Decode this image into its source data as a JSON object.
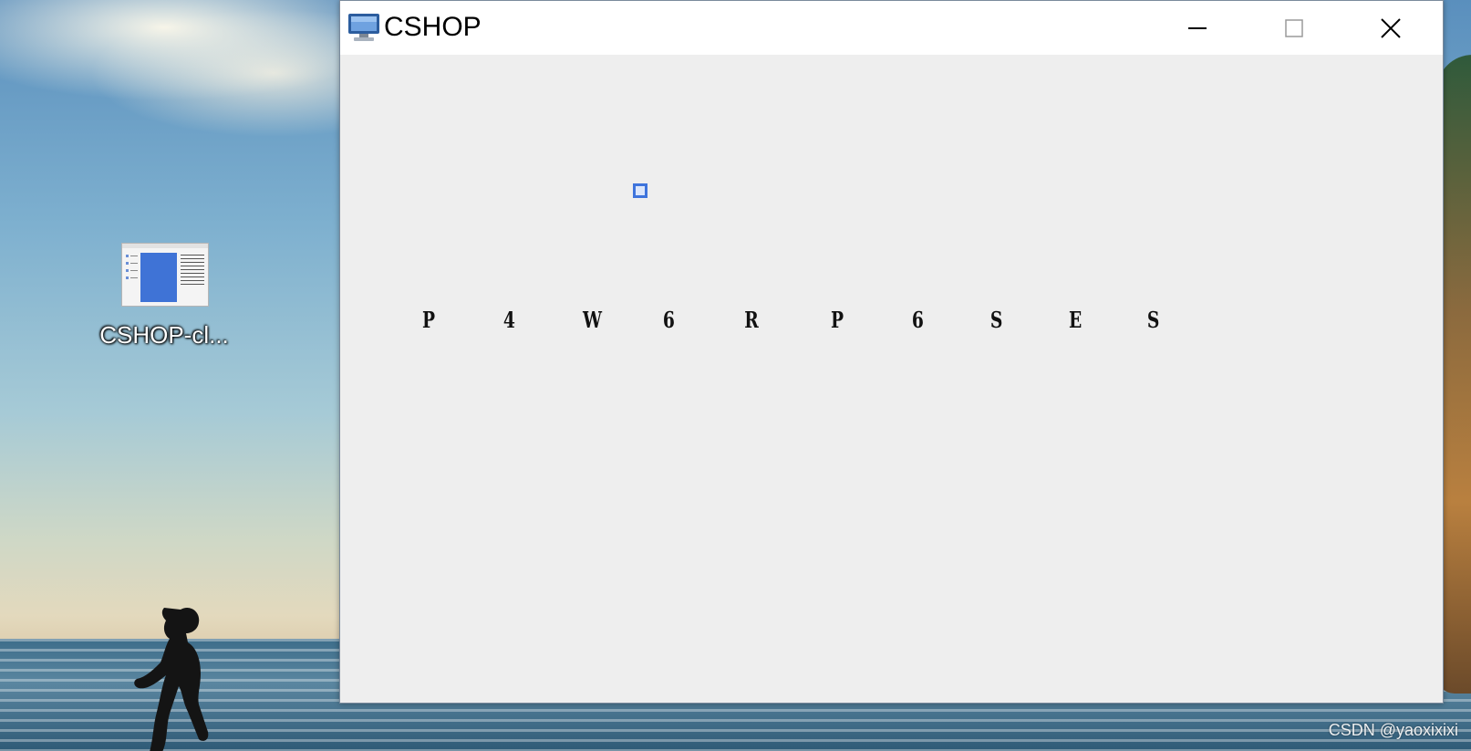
{
  "desktop": {
    "icon": {
      "label": "CSHOP-cl..."
    }
  },
  "window": {
    "title": "CSHOP",
    "captcha_chars": [
      "P",
      "4",
      "W",
      "6",
      "R",
      "P",
      "6",
      "S",
      "E",
      "S"
    ]
  },
  "watermark": "CSDN @yaoxixixi",
  "colors": {
    "focus_accent": "#3e74dc",
    "client_background": "#eeeeee",
    "titlebar_background": "#ffffff"
  },
  "icons": [
    "app-monitor-icon",
    "minimize-icon",
    "maximize-icon",
    "close-icon",
    "document-window-icon"
  ]
}
